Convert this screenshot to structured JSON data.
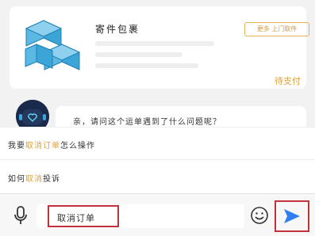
{
  "order": {
    "title": "寄件包裹",
    "action_button": "更多 上门取件",
    "status": "待支付"
  },
  "bot": {
    "message": "亲，请问这个运单遇到了什么问题呢？"
  },
  "suggestions": [
    {
      "prefix": "我要",
      "highlight": "取消订单",
      "suffix": "怎么操作"
    },
    {
      "prefix": "如何",
      "highlight": "取消",
      "suffix": "投诉"
    }
  ],
  "input": {
    "value": "取消订单"
  },
  "colors": {
    "accent": "#e0a03a",
    "send": "#2f7ff0",
    "highlight_box": "#c0333a"
  },
  "icons": {
    "mic": "microphone-icon",
    "emoji": "smiley-icon",
    "send": "send-arrow-icon",
    "avatar": "robot-avatar"
  }
}
